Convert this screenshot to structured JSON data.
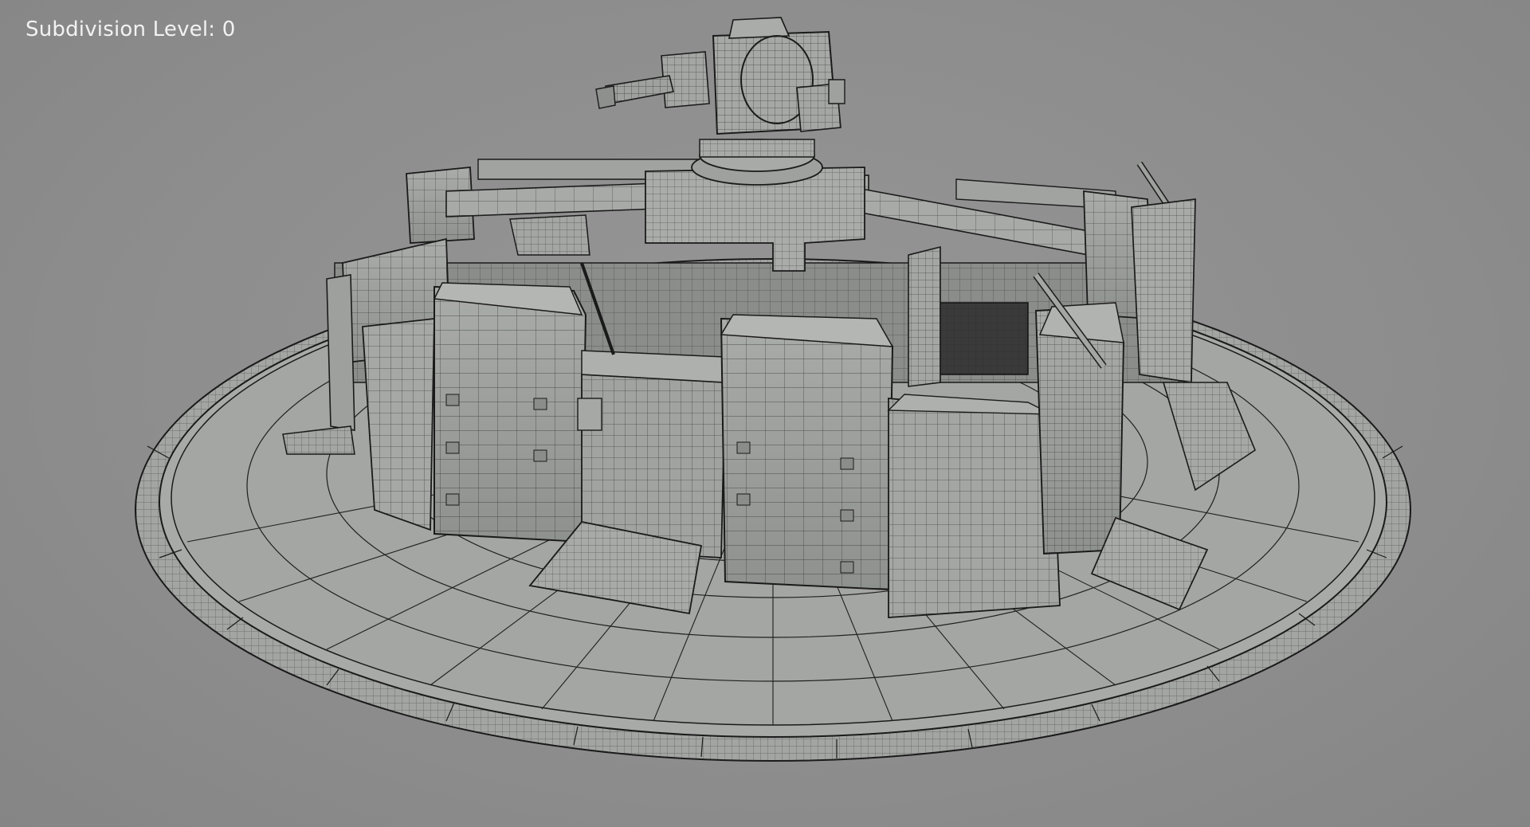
{
  "viewport": {
    "hud_label": "Subdivision Level: 0"
  },
  "scene": {
    "object": "wireframe-bunker-turret",
    "background_color": "#8e8e8e",
    "mesh_fill": "#9ea19e",
    "mesh_shadow": "#7d807d",
    "wire_color": "#1a1a1a"
  }
}
